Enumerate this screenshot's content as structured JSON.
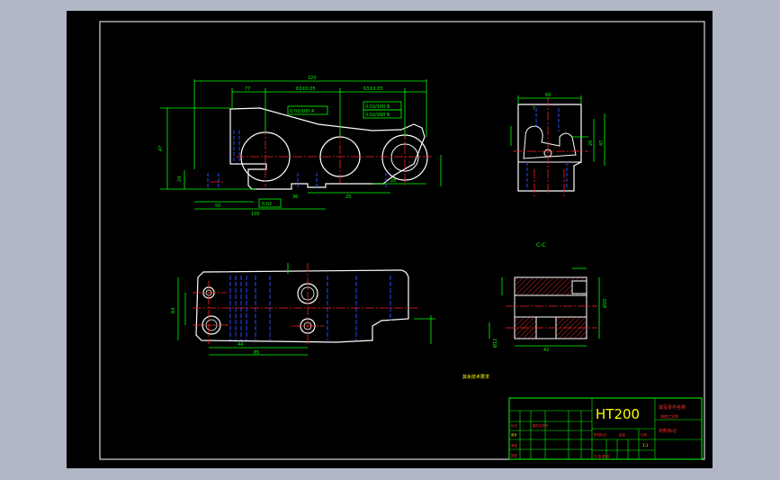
{
  "viewport": {
    "background": "#b1b7c5",
    "sheet_color": "#000000"
  },
  "colors": {
    "outline": "#ffffff",
    "dimension": "#00ff00",
    "centerline": "#ff2020",
    "hidden": "#2a4cff",
    "hatch": "#ff3030",
    "title_block": "#00ff00",
    "label": "#ffff00"
  },
  "title_block": {
    "material": "HT200",
    "part_name": "填写零件名称",
    "drawing_no": "材料标记",
    "school": "湖南工学院",
    "row_labels": [
      "标记",
      "处数",
      "分区",
      "更改文件号",
      "签名",
      "年月日"
    ],
    "row_labels_2": [
      "设计",
      "审核",
      "工艺",
      "批准"
    ],
    "stage_labels": [
      "阶段标记",
      "重量",
      "比例"
    ],
    "scale": "1:1",
    "sheet_info": "共 张 第 张"
  },
  "views": {
    "section_label": "C-C",
    "note": "其余技术要求"
  },
  "dimensions": {
    "overall_length": "220",
    "d1": "77",
    "d2": "63±0.05",
    "d3": "63±0.05",
    "height": "47",
    "d5": "24",
    "d6": "50",
    "d7": "100",
    "d8": "36",
    "d9": "25",
    "d10": "28",
    "tol1": "0.02/100 A",
    "tol2": "0.02/100 B",
    "tol3": "0.02/200 B",
    "tol4": "0.02",
    "right_width": "60",
    "right_h": "47",
    "right_s1": "20",
    "right_s2": "7",
    "section_w": "42",
    "section_d1": "Ø20",
    "section_d2": "Ø12",
    "bottom_len": "85",
    "bottom_d": "44",
    "bottom_h": "64"
  }
}
